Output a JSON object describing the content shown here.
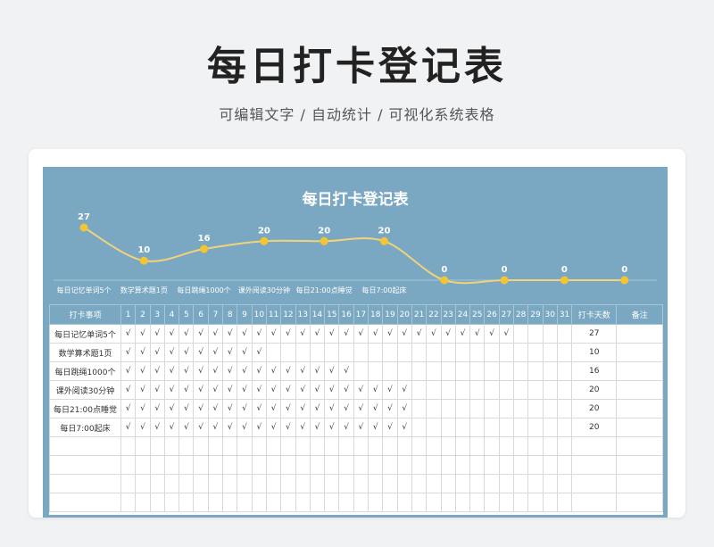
{
  "header": {
    "title": "每日打卡登记表",
    "subtitle": "可编辑文字 / 自动统计 / 可视化系统表格"
  },
  "sheet": {
    "title": "每日打卡登记表"
  },
  "colors": {
    "sheet_bg": "#7aa8c2",
    "line": "#f2d27a",
    "marker": "#f5c431"
  },
  "chart_data": {
    "type": "line",
    "categories": [
      "每日记忆单词5个",
      "数学算术题1页",
      "每日跳绳1000个",
      "课外阅读30分钟",
      "每日21:00点睡觉",
      "每日7:00起床",
      "",
      "",
      "",
      ""
    ],
    "values": [
      27,
      10,
      16,
      20,
      20,
      20,
      0,
      0,
      0,
      0
    ],
    "title": "每日打卡登记表",
    "smooth": true,
    "data_labels": true
  },
  "table": {
    "item_header": "打卡事项",
    "days": [
      "1",
      "2",
      "3",
      "4",
      "5",
      "6",
      "7",
      "8",
      "9",
      "10",
      "11",
      "12",
      "13",
      "14",
      "15",
      "16",
      "17",
      "18",
      "19",
      "20",
      "21",
      "22",
      "23",
      "24",
      "25",
      "26",
      "27",
      "28",
      "29",
      "30",
      "31"
    ],
    "total_header": "打卡天数",
    "note_header": "备注",
    "check_mark": "√",
    "rows": [
      {
        "item": "每日记忆单词5个",
        "days": 27,
        "total": "27",
        "note": ""
      },
      {
        "item": "数学算术题1页",
        "days": 10,
        "total": "10",
        "note": ""
      },
      {
        "item": "每日跳绳1000个",
        "days": 16,
        "total": "16",
        "note": ""
      },
      {
        "item": "课外阅读30分钟",
        "days": 20,
        "total": "20",
        "note": ""
      },
      {
        "item": "每日21:00点睡觉",
        "days": 20,
        "total": "20",
        "note": ""
      },
      {
        "item": "每日7:00起床",
        "days": 20,
        "total": "20",
        "note": ""
      },
      {
        "item": "",
        "days": 0,
        "total": "",
        "note": ""
      },
      {
        "item": "",
        "days": 0,
        "total": "",
        "note": ""
      },
      {
        "item": "",
        "days": 0,
        "total": "",
        "note": ""
      },
      {
        "item": "",
        "days": 0,
        "total": "",
        "note": ""
      }
    ]
  }
}
